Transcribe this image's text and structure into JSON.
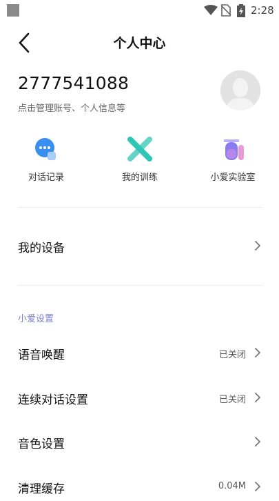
{
  "status_bar": {
    "time": "2:28"
  },
  "header": {
    "title": "个人中心"
  },
  "account": {
    "id": "2777541088",
    "subtitle": "点击管理账号、个人信息等"
  },
  "shortcuts": [
    {
      "label": "对话记录",
      "icon": "chat-bubble-icon"
    },
    {
      "label": "我的训练",
      "icon": "training-x-icon"
    },
    {
      "label": "小爱实验室",
      "icon": "lab-flask-icon"
    }
  ],
  "devices": {
    "label": "我的设备"
  },
  "xiaoai_settings": {
    "section_title": "小爱设置",
    "items": [
      {
        "label": "语音唤醒",
        "value": "已关闭"
      },
      {
        "label": "连续对话设置",
        "value": "已关闭"
      },
      {
        "label": "音色设置",
        "value": ""
      },
      {
        "label": "清理缓存",
        "value": "0.04M"
      }
    ]
  },
  "colors": {
    "accent": "#7b7fd0",
    "chat_blue": "#3a8ef0",
    "training_teal": "#2fc6b5",
    "lab_purple": "#8a7cf0"
  }
}
